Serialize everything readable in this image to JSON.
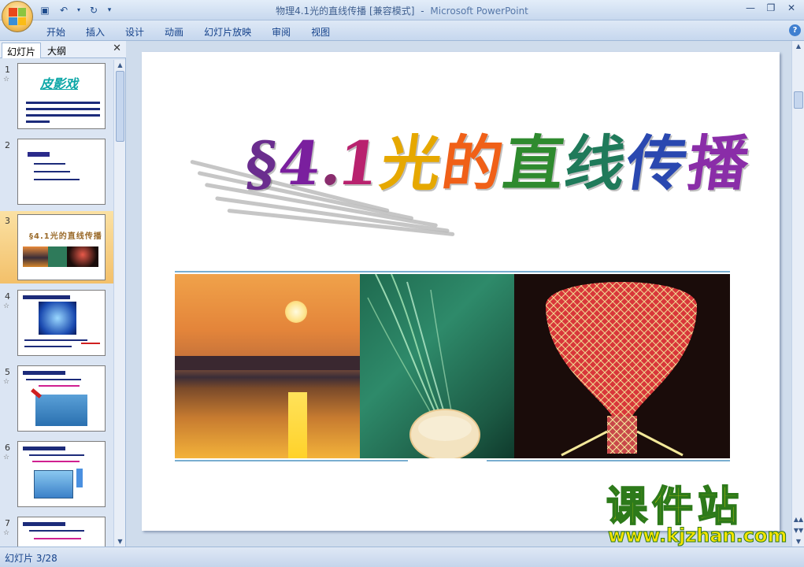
{
  "window": {
    "title_file": "物理4.1光的直线传播",
    "title_mode": "[兼容模式]",
    "title_sep": "-",
    "title_app": "Microsoft PowerPoint"
  },
  "ribbon": {
    "tabs": [
      "开始",
      "插入",
      "设计",
      "动画",
      "幻灯片放映",
      "审阅",
      "视图"
    ]
  },
  "left_pane": {
    "tab_slides": "幻灯片",
    "tab_outline": "大纲",
    "thumbnails": [
      {
        "num": "1",
        "selected": false,
        "title": "皮影戏"
      },
      {
        "num": "2",
        "selected": false,
        "title": ""
      },
      {
        "num": "3",
        "selected": true,
        "title": "§4.1光的直线传播"
      },
      {
        "num": "4",
        "selected": false,
        "title": ""
      },
      {
        "num": "5",
        "selected": false,
        "title": ""
      },
      {
        "num": "6",
        "selected": false,
        "title": ""
      },
      {
        "num": "7",
        "selected": false,
        "title": ""
      }
    ]
  },
  "slide": {
    "title_chars": [
      "§",
      "4",
      ".",
      "1",
      "光",
      "的",
      "直",
      "线",
      "传",
      "播"
    ],
    "title_colors": [
      "#6a2d8e",
      "#7a1f9e",
      "#8a2d6e",
      "#b8226e",
      "#e6a800",
      "#f06018",
      "#2e8a2e",
      "#1f7a5a",
      "#2a48b0",
      "#8a2da8"
    ]
  },
  "status": {
    "slide_indicator": "幻灯片 3/28"
  },
  "watermark": {
    "text": "课件站",
    "url": "www.kjzhan.com"
  }
}
